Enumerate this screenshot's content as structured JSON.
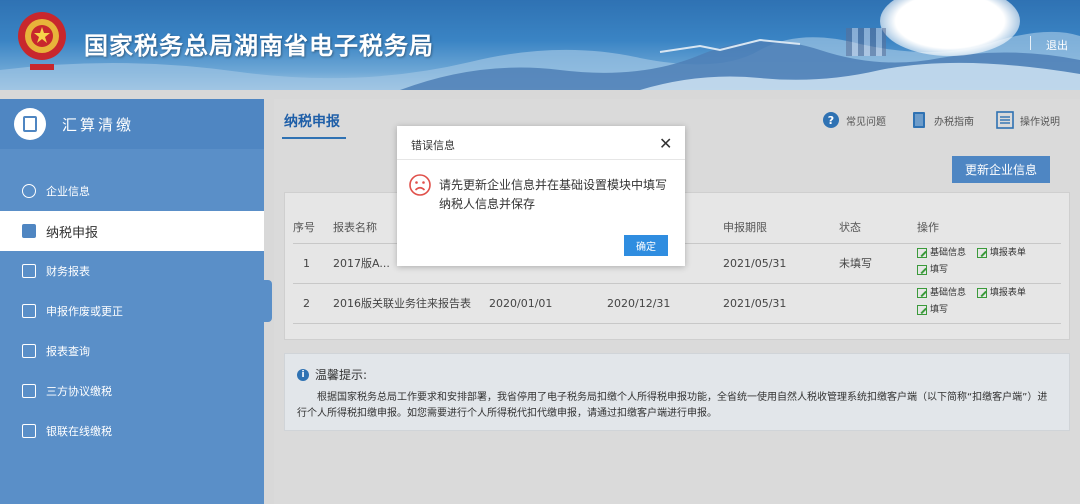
{
  "header": {
    "title": "国家税务总局湖南省电子税务局",
    "logout": "退出"
  },
  "sidebar": {
    "title": "汇算清缴",
    "items": [
      {
        "label": "企业信息",
        "icon": "info-circle-icon"
      },
      {
        "label": "纳税申报",
        "icon": "edit-icon",
        "active": true
      },
      {
        "label": "财务报表",
        "icon": "image-icon"
      },
      {
        "label": "申报作废或更正",
        "icon": "document-icon"
      },
      {
        "label": "报表查询",
        "icon": "folder-icon"
      },
      {
        "label": "三方协议缴税",
        "icon": "document-icon"
      },
      {
        "label": "银联在线缴税",
        "icon": "document-icon"
      }
    ]
  },
  "main": {
    "tab": "纳税申报",
    "tools": [
      {
        "label": "常见问题",
        "icon": "question-icon"
      },
      {
        "label": "办税指南",
        "icon": "book-icon"
      },
      {
        "label": "操作说明",
        "icon": "list-icon"
      }
    ],
    "update_button": "更新企业信息",
    "table": {
      "headers": [
        "序号",
        "报表名称",
        "",
        "",
        "申报期限",
        "状态",
        "操作"
      ],
      "rows": [
        {
          "no": "1",
          "name": "2017版A...",
          "start": "",
          "end": "",
          "deadline": "2021/05/31",
          "status": "未填写",
          "ops": [
            "基础信息",
            "填报表单",
            "填写"
          ]
        },
        {
          "no": "2",
          "name": "2016版关联业务往来报告表",
          "start": "2020/01/01",
          "end": "2020/12/31",
          "deadline": "2021/05/31",
          "status": "",
          "ops": [
            "基础信息",
            "填报表单",
            "填写"
          ]
        }
      ]
    },
    "tips": {
      "title": "温馨提示:",
      "body": "根据国家税务总局工作要求和安排部署，我省停用了电子税务局扣缴个人所得税申报功能，全省统一使用自然人税收管理系统扣缴客户端（以下简称“扣缴客户端”）进行个人所得税扣缴申报。如您需要进行个人所得税代扣代缴申报，请通过扣缴客户端进行申报。"
    }
  },
  "dialog": {
    "title": "错误信息",
    "close": "✕",
    "message": "请先更新企业信息并在基础设置模块中填写纳税人信息并保存",
    "ok": "确定"
  },
  "colors": {
    "header_blue": "#2f72b3",
    "sidebar_blue": "#5a8fc8",
    "button_blue": "#4e86c3",
    "dialog_ok": "#2f8de0"
  }
}
